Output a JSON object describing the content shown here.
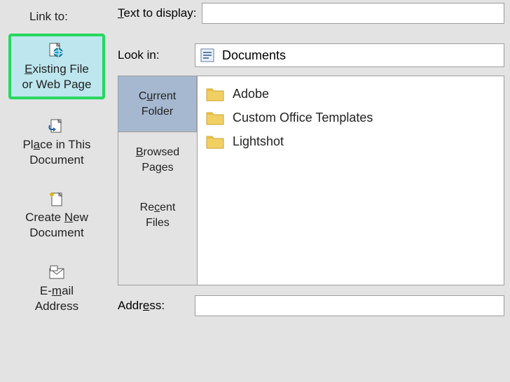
{
  "linkto_label": "Link to:",
  "text_to_display_label": "Text to display:",
  "text_to_display_value": "",
  "look_in_label": "Look in:",
  "look_in_value": "Documents",
  "address_label": "Address:",
  "address_value": "",
  "linkto_options": [
    {
      "line1": "Existing File",
      "line2": "or Web Page"
    },
    {
      "line1": "Place in This",
      "line2": "Document"
    },
    {
      "line1": "Create New",
      "line2": "Document"
    },
    {
      "line1": "E-mail",
      "line2": "Address"
    }
  ],
  "browse_tabs": [
    {
      "line1": "Current",
      "line2": "Folder"
    },
    {
      "line1": "Browsed",
      "line2": "Pages"
    },
    {
      "line1": "Recent",
      "line2": "Files"
    }
  ],
  "files": [
    {
      "name": "Adobe"
    },
    {
      "name": "Custom Office Templates"
    },
    {
      "name": "Lightshot"
    }
  ]
}
